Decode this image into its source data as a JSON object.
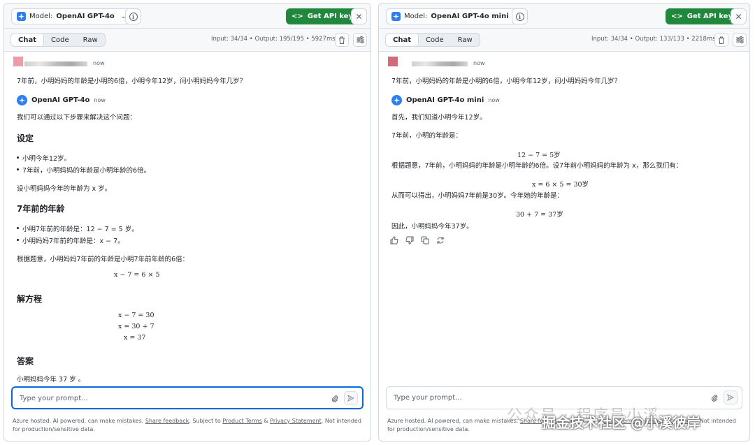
{
  "left": {
    "model_label": "Model:",
    "model_name": "OpenAI GPT-4o",
    "api_button": "Get API key",
    "tabs": [
      "Chat",
      "Code",
      "Raw"
    ],
    "stats": "Input: 34/34 • Output: 195/195 • 5927ms",
    "user_ts": "now",
    "user_msg": "7年前，小明妈妈的年龄是小明的6倍，小明今年12岁，问小明妈妈今年几岁？",
    "bot_name": "OpenAI GPT-4o",
    "bot_ts": "now",
    "intro": "我们可以通过以下步骤来解决这个问题：",
    "h_setting": "设定",
    "setting_items": [
      "小明今年12岁。",
      "7年前，小明妈妈的年龄是小明年龄的6倍。"
    ],
    "let_text": "设小明妈妈今年的年龄为 x 岁。",
    "h_age": "7年前的年龄",
    "age_items": [
      "小明7年前的年龄是：12 − 7 = 5 岁。",
      "小明妈妈7年前的年龄是：x − 7。"
    ],
    "by_text": "根据题意，小明妈妈7年前的年龄是小明7年前年龄的6倍：",
    "eq1": "x − 7 = 6 × 5",
    "h_solve": "解方程",
    "solve_lines": [
      "x − 7 = 30",
      "x = 30 + 7",
      "x = 37"
    ],
    "h_answer": "答案",
    "answer": "小明妈妈今年 37 岁 。",
    "placeholder": "Type your prompt..."
  },
  "right": {
    "model_label": "Model:",
    "model_name": "OpenAI GPT-4o mini",
    "api_button": "Get API key",
    "tabs": [
      "Chat",
      "Code",
      "Raw"
    ],
    "stats": "Input: 34/34 • Output: 133/133 • 2218ms",
    "user_ts": "now",
    "user_msg": "7年前，小明妈妈的年龄是小明的6倍，小明今年12岁，问小明妈妈今年几岁？",
    "bot_name": "OpenAI GPT-4o mini",
    "bot_ts": "now",
    "l1": "首先，我们知道小明今年12岁。",
    "l2": "7年前，小明的年龄是：",
    "eq1": "12 − 7 = 5岁",
    "l3": "根据题意，7年前，小明妈妈的年龄是小明年龄的6倍。设7年前小明妈妈的年龄为 x，那么我们有：",
    "eq2": "x = 6 × 5 = 30岁",
    "l4": "从而可以得出，小明妈妈7年前是30岁。今年她的年龄是：",
    "eq3": "30 + 7 = 37岁",
    "l5": "因此，小明妈妈今年37岁。",
    "placeholder": "Type your prompt..."
  },
  "footer": {
    "p1": "Azure hosted. AI powered, can make mistakes. ",
    "share": "Share feedback",
    "p2": ". Subject to ",
    "terms": "Product Terms",
    "p3": " & ",
    "privacy": "Privacy Statement",
    "p4": ". Not intended for production/sensitive data."
  },
  "watermark": {
    "text1": "公众号 · 程序员小溪",
    "text2": "掘金技术社区 @小溪彼岸"
  },
  "colors": {
    "accent": "#1f883d",
    "focus": "#0969da",
    "brand": "#2f80ed"
  }
}
